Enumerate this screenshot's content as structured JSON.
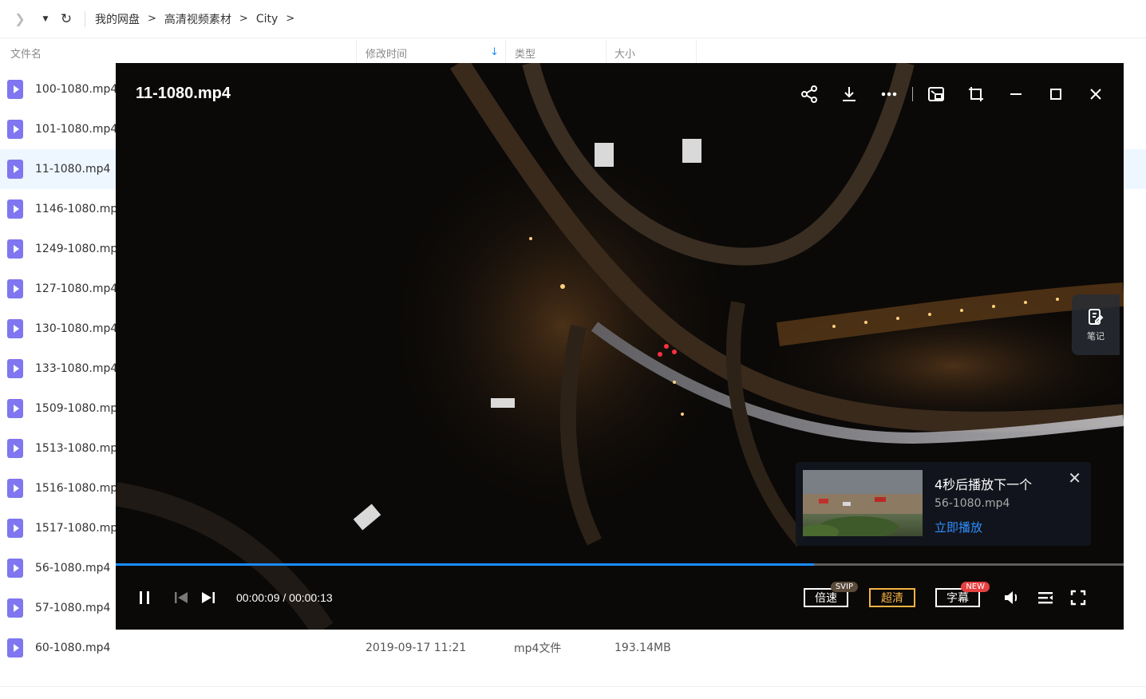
{
  "breadcrumb": [
    "我的网盘",
    "高清视频素材",
    "City"
  ],
  "breadcrumb_sep": ">",
  "columns": {
    "name": "文件名",
    "time": "修改时间",
    "type": "类型",
    "size": "大小"
  },
  "files": [
    {
      "name": "100-1080.mp4",
      "time": "",
      "type": "",
      "size": ""
    },
    {
      "name": "101-1080.mp4",
      "time": "",
      "type": "",
      "size": ""
    },
    {
      "name": "11-1080.mp4",
      "time": "",
      "type": "",
      "size": ""
    },
    {
      "name": "1146-1080.mp",
      "time": "",
      "type": "",
      "size": ""
    },
    {
      "name": "1249-1080.mp",
      "time": "",
      "type": "",
      "size": ""
    },
    {
      "name": "127-1080.mp4",
      "time": "",
      "type": "",
      "size": ""
    },
    {
      "name": "130-1080.mp4",
      "time": "",
      "type": "",
      "size": ""
    },
    {
      "name": "133-1080.mp4",
      "time": "",
      "type": "",
      "size": ""
    },
    {
      "name": "1509-1080.mp",
      "time": "",
      "type": "",
      "size": ""
    },
    {
      "name": "1513-1080.mp",
      "time": "",
      "type": "",
      "size": ""
    },
    {
      "name": "1516-1080.mp",
      "time": "",
      "type": "",
      "size": ""
    },
    {
      "name": "1517-1080.mp",
      "time": "",
      "type": "",
      "size": ""
    },
    {
      "name": "56-1080.mp4",
      "time": "",
      "type": "",
      "size": ""
    },
    {
      "name": "57-1080.mp4",
      "time": "",
      "type": "",
      "size": ""
    },
    {
      "name": "60-1080.mp4",
      "time": "2019-09-17 11:21",
      "type": "mp4文件",
      "size": "193.14MB"
    }
  ],
  "player": {
    "title": "11-1080.mp4",
    "note_label": "笔记",
    "progress_fraction": 0.693,
    "time_current": "00:00:09",
    "time_total": "00:00:13",
    "speed_label": "倍速",
    "speed_badge": "SVIP",
    "quality_label": "超清",
    "subtitle_label": "字幕",
    "subtitle_badge": "NEW",
    "colors": {
      "accent": "#1a8cff",
      "quality": "#f5b342",
      "link": "#2e8fff"
    }
  },
  "nextup": {
    "title": "4秒后播放下一个",
    "filename": "56-1080.mp4",
    "play_now": "立即播放"
  }
}
